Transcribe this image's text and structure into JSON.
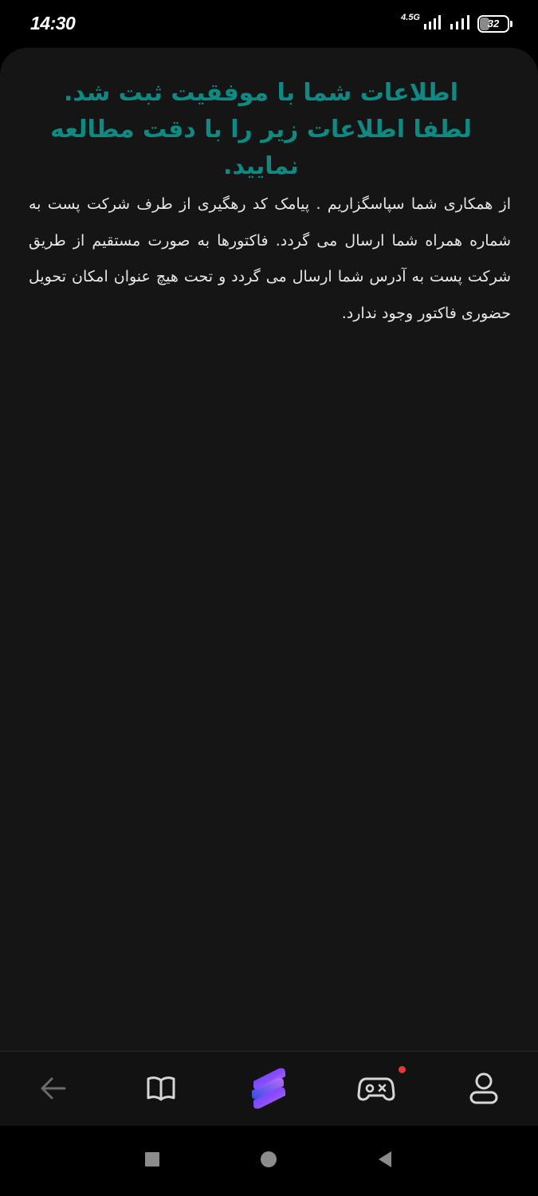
{
  "status_bar": {
    "time": "14:30",
    "network_type": "4.5G",
    "battery_percent": "32",
    "battery_level": 0.32,
    "icons": [
      "signal-icon",
      "signal-icon",
      "battery-icon"
    ]
  },
  "main": {
    "heading": "اطلاعات شما با موفقیت ثبت شد. لطفا اطلاعات زیر را با دقت مطالعه نمایید.",
    "body": "از همکاری شما سپاسگزاریم . پیامک کد رهگیری از طرف شرکت پست به شماره همراه شما ارسال می گردد. فاکتورها به صورت مستقیم از طریق شرکت پست به آدرس شما ارسال می گردد و تحت هیچ عنوان امکان تحویل حضوری فاکتور وجود ندارد."
  },
  "bottom_nav": {
    "items": [
      {
        "icon": "back-arrow-icon"
      },
      {
        "icon": "book-icon"
      },
      {
        "icon": "app-logo-icon"
      },
      {
        "icon": "gamepad-icon",
        "has_notification": true
      },
      {
        "icon": "profile-icon"
      }
    ]
  },
  "system_nav": {
    "items": [
      {
        "icon": "recents-square-icon"
      },
      {
        "icon": "home-circle-icon"
      },
      {
        "icon": "back-triangle-icon"
      }
    ]
  },
  "colors": {
    "accent": "#0f8a82",
    "card_background": "#151515",
    "body_text": "#e7e7e7",
    "notification_dot": "#e53935",
    "logo_gradient": [
      "#3a4ff0",
      "#8a4bff",
      "#c070ff"
    ]
  }
}
